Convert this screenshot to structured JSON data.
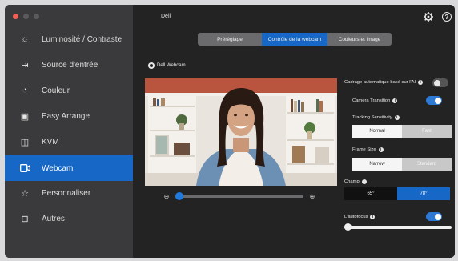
{
  "window": {
    "title": "Dell",
    "traffic_colors": [
      "#ee5f57",
      "#5a5a5c",
      "#5a5a5c"
    ]
  },
  "sidebar": {
    "items": [
      {
        "label": "Luminosité / Contraste",
        "icon": "brightness-icon",
        "glyph": "☼"
      },
      {
        "label": "Source d'entrée",
        "icon": "input-source-icon",
        "glyph": "⇥"
      },
      {
        "label": "Couleur",
        "icon": "palette-icon",
        "glyph": "◔"
      },
      {
        "label": "Easy Arrange",
        "icon": "easy-arrange-icon",
        "glyph": "▣"
      },
      {
        "label": "KVM",
        "icon": "kvm-icon",
        "glyph": "◫"
      },
      {
        "label": "Webcam",
        "icon": "webcam-icon",
        "glyph": "▭"
      },
      {
        "label": "Personnaliser",
        "icon": "star-icon",
        "glyph": "☆"
      },
      {
        "label": "Autres",
        "icon": "others-icon",
        "glyph": "⊟"
      }
    ],
    "active_index": 5
  },
  "tabs": {
    "items": [
      "Préréglage",
      "Contrôle de la webcam",
      "Couleurs et image"
    ],
    "active_index": 1
  },
  "webcam": {
    "device_label": "Dell Webcam",
    "zoom_level": 0.03
  },
  "settings": {
    "auto_framing_label": "Cadrage automatique basé sur l'AI",
    "auto_framing_on": false,
    "camera_transition_label": "Camera Transition",
    "camera_transition_on": true,
    "tracking_sensitivity_label": "Tracking Sensitivity",
    "tracking_options": [
      "Normal",
      "Fast"
    ],
    "tracking_selected": "Fast",
    "frame_size_label": "Frame Size",
    "frame_size_options": [
      "Narrow",
      "Standard"
    ],
    "frame_size_selected": "Standard",
    "fov_label": "Champ",
    "fov_options": [
      "65°",
      "78°"
    ],
    "fov_selected": "78°",
    "autofocus_label": "L'autofocus",
    "autofocus_on": true
  },
  "colors": {
    "accent": "#1767c6",
    "sidebar_bg": "#3a3a3c",
    "main_bg": "#232323"
  }
}
